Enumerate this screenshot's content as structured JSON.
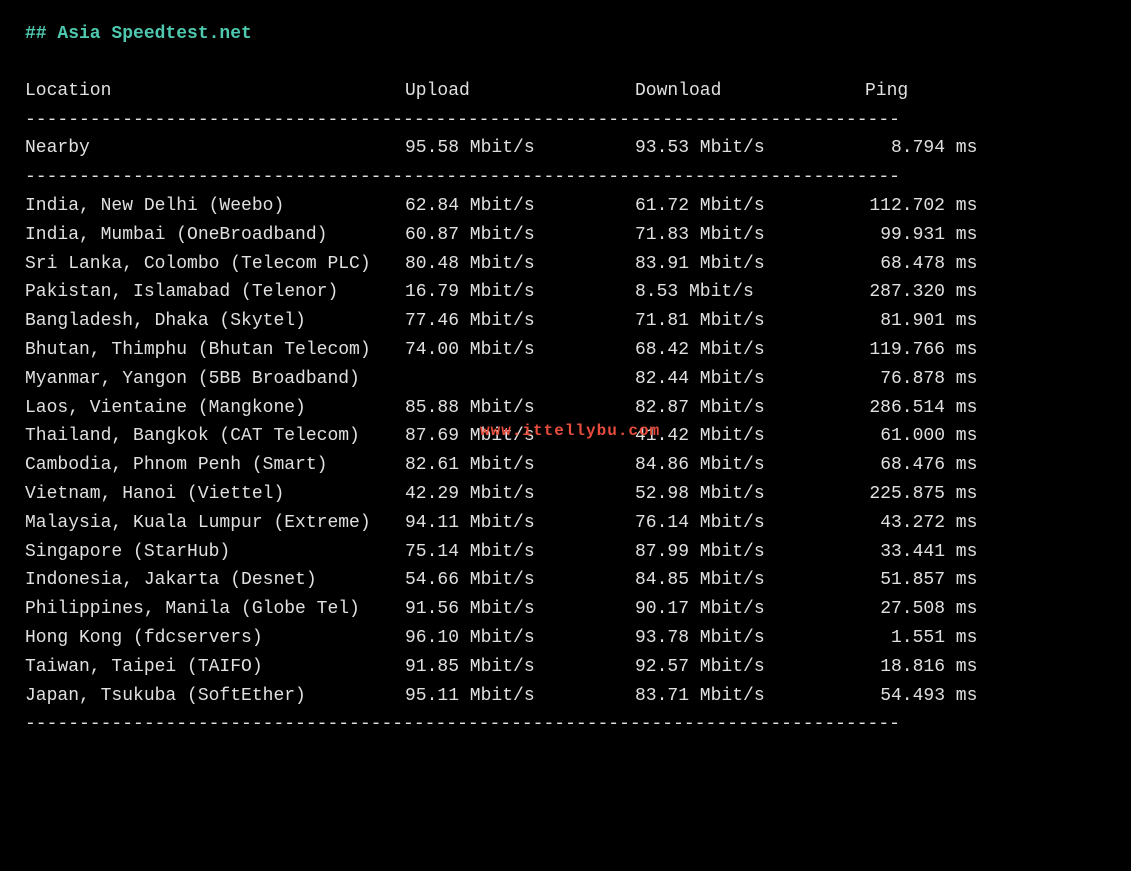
{
  "title": "## Asia Speedtest.net",
  "headers": {
    "location": "Location",
    "upload": "Upload",
    "download": "Download",
    "ping": "Ping"
  },
  "divider": "---------------------------------------------------------------------------------",
  "nearby": {
    "location": "Nearby",
    "upload": "95.58 Mbit/s",
    "download": "93.53 Mbit/s",
    "ping_val": "8.794",
    "ping_unit": " ms"
  },
  "rows": [
    {
      "location": "India, New Delhi (Weebo)",
      "upload": "62.84 Mbit/s",
      "download": "61.72 Mbit/s",
      "ping_val": "112.702",
      "ping_unit": " ms"
    },
    {
      "location": "India, Mumbai (OneBroadband)",
      "upload": "60.87 Mbit/s",
      "download": "71.83 Mbit/s",
      "ping_val": "99.931",
      "ping_unit": " ms"
    },
    {
      "location": "Sri Lanka, Colombo (Telecom PLC)",
      "upload": "80.48 Mbit/s",
      "download": "83.91 Mbit/s",
      "ping_val": "68.478",
      "ping_unit": " ms"
    },
    {
      "location": "Pakistan, Islamabad (Telenor)",
      "upload": "16.79 Mbit/s",
      "download": "8.53 Mbit/s",
      "ping_val": "287.320",
      "ping_unit": " ms"
    },
    {
      "location": "Bangladesh, Dhaka (Skytel)",
      "upload": "77.46 Mbit/s",
      "download": "71.81 Mbit/s",
      "ping_val": "81.901",
      "ping_unit": " ms"
    },
    {
      "location": "Bhutan, Thimphu (Bhutan Telecom)",
      "upload": "74.00 Mbit/s",
      "download": "68.42 Mbit/s",
      "ping_val": "119.766",
      "ping_unit": " ms"
    },
    {
      "location": "Myanmar, Yangon (5BB Broadband)",
      "upload": "",
      "download": "82.44 Mbit/s",
      "ping_val": "76.878",
      "ping_unit": " ms"
    },
    {
      "location": "Laos, Vientaine (Mangkone)",
      "upload": "85.88 Mbit/s",
      "download": "82.87 Mbit/s",
      "ping_val": "286.514",
      "ping_unit": " ms"
    },
    {
      "location": "Thailand, Bangkok (CAT Telecom)",
      "upload": "87.69 Mbit/s",
      "download": "41.42 Mbit/s",
      "ping_val": "61.000",
      "ping_unit": " ms"
    },
    {
      "location": "Cambodia, Phnom Penh (Smart)",
      "upload": "82.61 Mbit/s",
      "download": "84.86 Mbit/s",
      "ping_val": "68.476",
      "ping_unit": " ms"
    },
    {
      "location": "Vietnam, Hanoi (Viettel)",
      "upload": "42.29 Mbit/s",
      "download": "52.98 Mbit/s",
      "ping_val": "225.875",
      "ping_unit": " ms"
    },
    {
      "location": "Malaysia, Kuala Lumpur (Extreme)",
      "upload": "94.11 Mbit/s",
      "download": "76.14 Mbit/s",
      "ping_val": "43.272",
      "ping_unit": " ms"
    },
    {
      "location": "Singapore (StarHub)",
      "upload": "75.14 Mbit/s",
      "download": "87.99 Mbit/s",
      "ping_val": "33.441",
      "ping_unit": " ms"
    },
    {
      "location": "Indonesia, Jakarta (Desnet)",
      "upload": "54.66 Mbit/s",
      "download": "84.85 Mbit/s",
      "ping_val": "51.857",
      "ping_unit": " ms"
    },
    {
      "location": "Philippines, Manila (Globe Tel)",
      "upload": "91.56 Mbit/s",
      "download": "90.17 Mbit/s",
      "ping_val": "27.508",
      "ping_unit": " ms"
    },
    {
      "location": "Hong Kong (fdcservers)",
      "upload": "96.10 Mbit/s",
      "download": "93.78 Mbit/s",
      "ping_val": "1.551",
      "ping_unit": " ms"
    },
    {
      "location": "Taiwan, Taipei (TAIFO)",
      "upload": "91.85 Mbit/s",
      "download": "92.57 Mbit/s",
      "ping_val": "18.816",
      "ping_unit": " ms"
    },
    {
      "location": "Japan, Tsukuba (SoftEther)",
      "upload": "95.11 Mbit/s",
      "download": "83.71 Mbit/s",
      "ping_val": "54.493",
      "ping_unit": " ms"
    }
  ],
  "watermark": "www.ittellybu.com"
}
